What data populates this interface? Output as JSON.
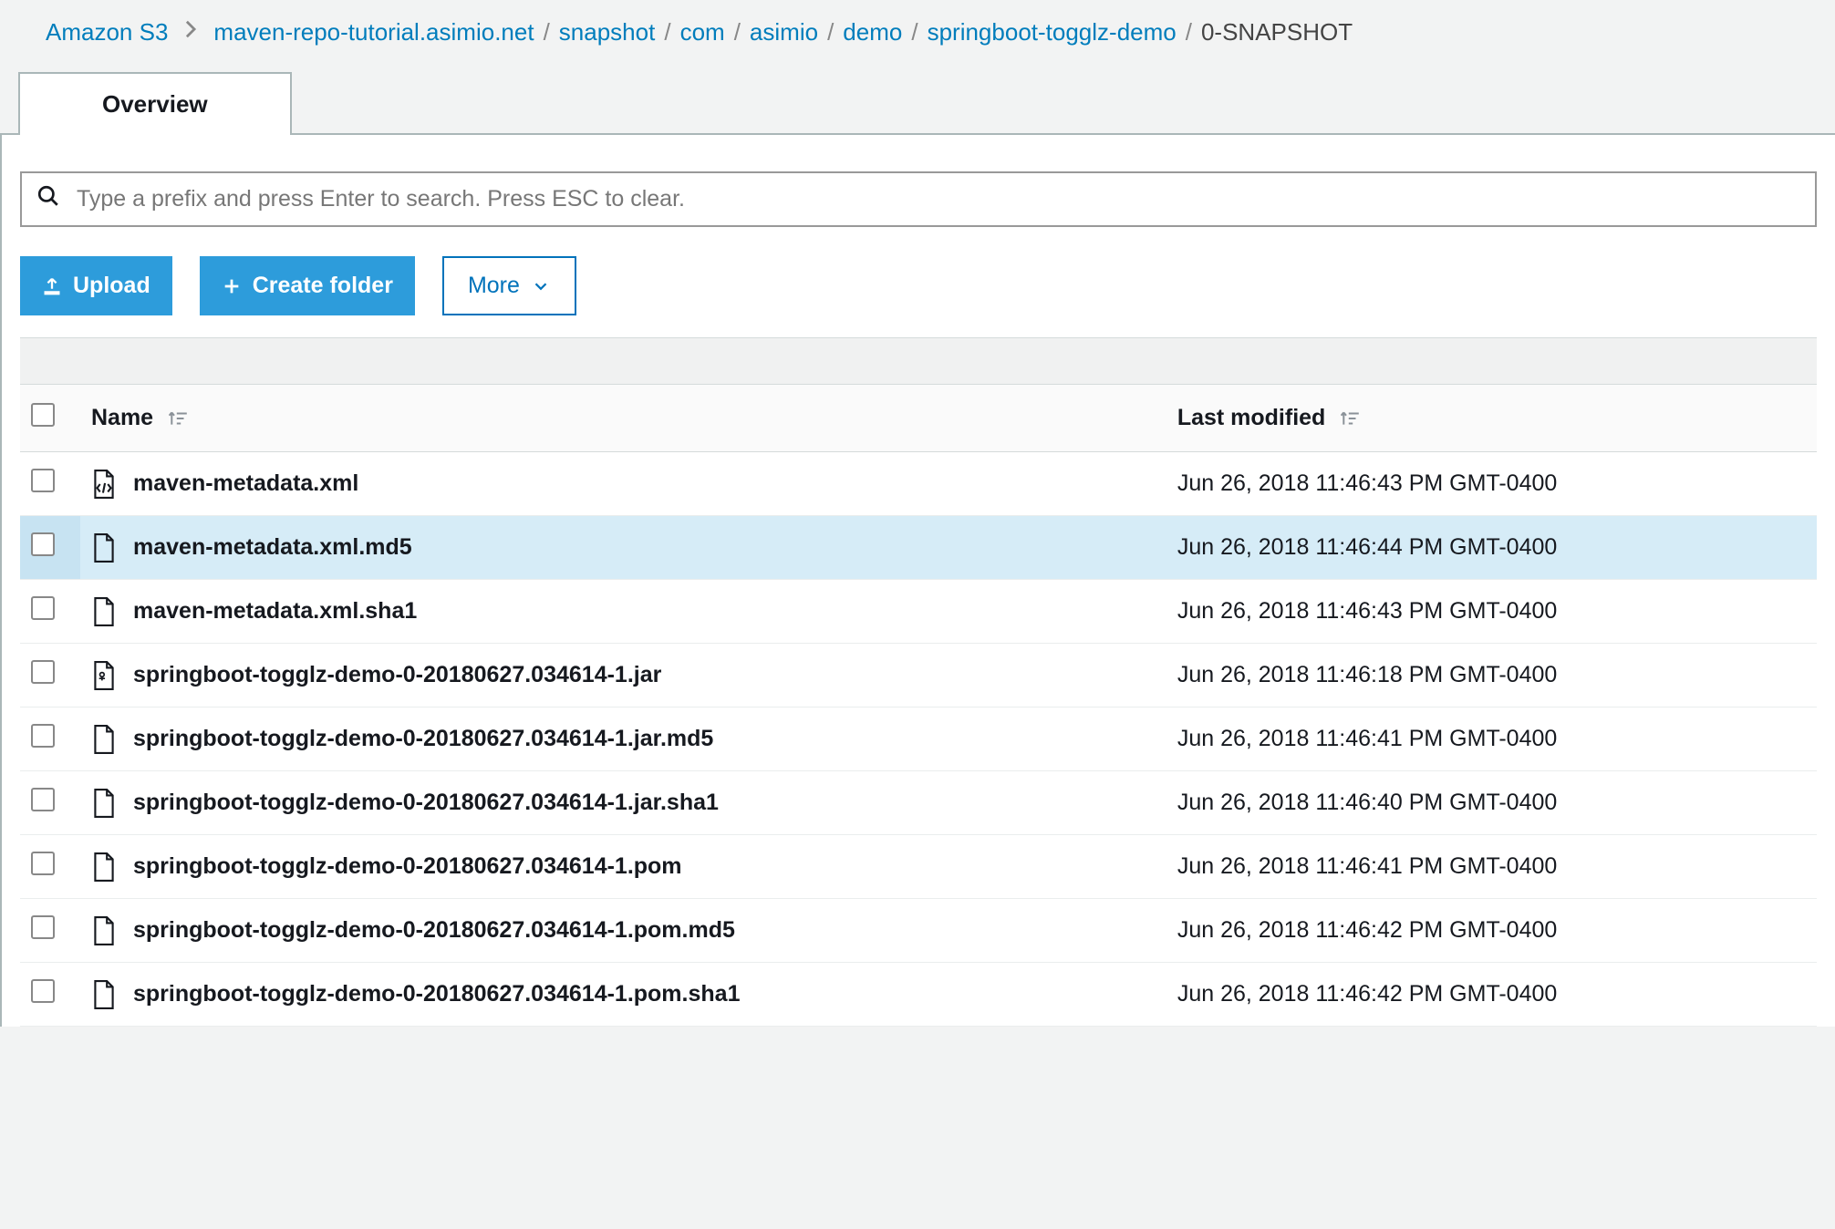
{
  "breadcrumb": {
    "root": "Amazon S3",
    "segments": [
      "maven-repo-tutorial.asimio.net",
      "snapshot",
      "com",
      "asimio",
      "demo",
      "springboot-togglz-demo"
    ],
    "current": "0-SNAPSHOT"
  },
  "tabs": {
    "overview": "Overview"
  },
  "search": {
    "placeholder": "Type a prefix and press Enter to search. Press ESC to clear."
  },
  "actions": {
    "upload": "Upload",
    "create_folder": "Create folder",
    "more": "More"
  },
  "columns": {
    "name": "Name",
    "last_modified": "Last modified"
  },
  "rows": [
    {
      "icon": "xml",
      "name": "maven-metadata.xml",
      "modified": "Jun 26, 2018 11:46:43 PM GMT-0400",
      "highlight": false
    },
    {
      "icon": "file",
      "name": "maven-metadata.xml.md5",
      "modified": "Jun 26, 2018 11:46:44 PM GMT-0400",
      "highlight": true
    },
    {
      "icon": "file",
      "name": "maven-metadata.xml.sha1",
      "modified": "Jun 26, 2018 11:46:43 PM GMT-0400",
      "highlight": false
    },
    {
      "icon": "jar",
      "name": "springboot-togglz-demo-0-20180627.034614-1.jar",
      "modified": "Jun 26, 2018 11:46:18 PM GMT-0400",
      "highlight": false
    },
    {
      "icon": "file",
      "name": "springboot-togglz-demo-0-20180627.034614-1.jar.md5",
      "modified": "Jun 26, 2018 11:46:41 PM GMT-0400",
      "highlight": false
    },
    {
      "icon": "file",
      "name": "springboot-togglz-demo-0-20180627.034614-1.jar.sha1",
      "modified": "Jun 26, 2018 11:46:40 PM GMT-0400",
      "highlight": false
    },
    {
      "icon": "file",
      "name": "springboot-togglz-demo-0-20180627.034614-1.pom",
      "modified": "Jun 26, 2018 11:46:41 PM GMT-0400",
      "highlight": false
    },
    {
      "icon": "file",
      "name": "springboot-togglz-demo-0-20180627.034614-1.pom.md5",
      "modified": "Jun 26, 2018 11:46:42 PM GMT-0400",
      "highlight": false
    },
    {
      "icon": "file",
      "name": "springboot-togglz-demo-0-20180627.034614-1.pom.sha1",
      "modified": "Jun 26, 2018 11:46:42 PM GMT-0400",
      "highlight": false
    }
  ]
}
